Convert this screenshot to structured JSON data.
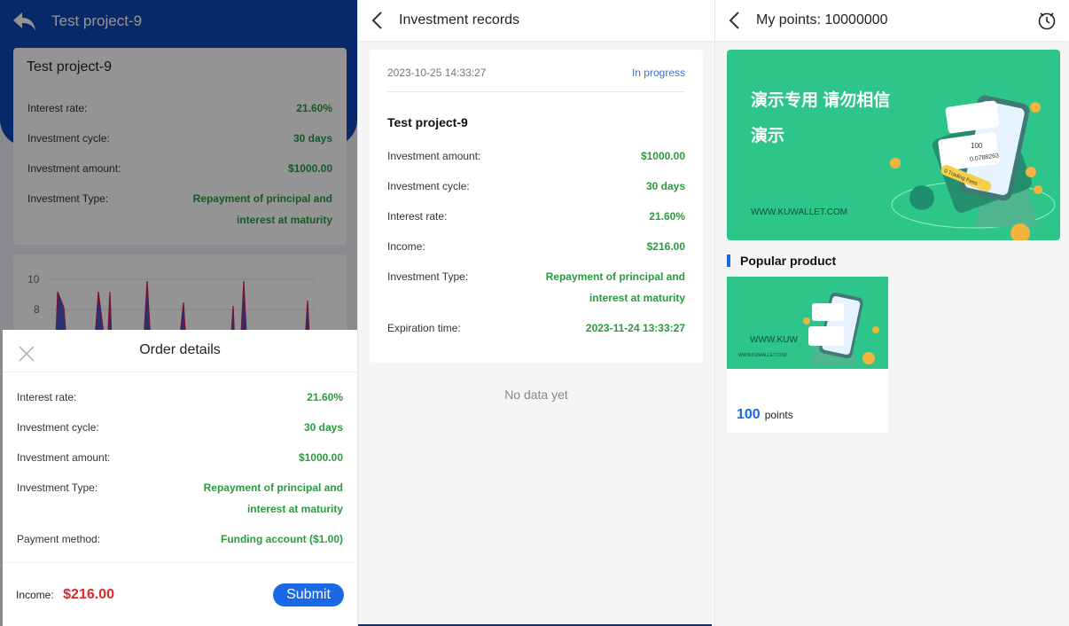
{
  "colors": {
    "brand_blue": "#0d47b5",
    "accent_blue": "#1968e6",
    "value_green": "#2a9a3f",
    "income_red": "#e0262b",
    "banner_green": "#2ec58a"
  },
  "project_page": {
    "title": "Test project-9",
    "card": {
      "title": "Test project-9",
      "rows": [
        {
          "label": "Interest rate:",
          "value": "21.60%"
        },
        {
          "label": "Investment cycle:",
          "value": "30 days"
        },
        {
          "label": "Investment amount:",
          "value": "$1000.00"
        },
        {
          "label": "Investment Type:",
          "value_line1": "Repayment of principal and",
          "value_line2": "interest at maturity"
        }
      ]
    },
    "chart_data": {
      "type": "area",
      "yticks": [
        "10",
        "8"
      ]
    }
  },
  "order_sheet": {
    "title": "Order details",
    "rows": [
      {
        "label": "Interest rate:",
        "value": "21.60%"
      },
      {
        "label": "Investment cycle:",
        "value": "30 days"
      },
      {
        "label": "Investment amount:",
        "value": "$1000.00"
      },
      {
        "label": "Investment Type:",
        "value_line1": "Repayment of principal and",
        "value_line2": "interest at maturity"
      },
      {
        "label": "Payment method:",
        "value": "Funding account ($1.00)"
      }
    ],
    "income_label": "Income:",
    "income_value": "$216.00",
    "submit_label": "Submit"
  },
  "records_page": {
    "title": "Investment records",
    "record": {
      "date": "2023-10-25 14:33:27",
      "status": "In progress",
      "name": "Test project-9",
      "rows": [
        {
          "label": "Investment amount:",
          "value": "$1000.00"
        },
        {
          "label": "Investment cycle:",
          "value": "30 days"
        },
        {
          "label": "Interest rate:",
          "value": "21.60%"
        },
        {
          "label": "Income:",
          "value": "$216.00"
        },
        {
          "label": "Investment Type:",
          "value_line1": "Repayment of principal and",
          "value_line2": "interest at maturity"
        },
        {
          "label": "Expiration time:",
          "value": "2023-11-24 13:33:27"
        }
      ]
    },
    "empty_text": "No data yet"
  },
  "points_page": {
    "title": "My points: 10000000",
    "banner": {
      "line1": "演示专用 请勿相信",
      "line2": "演示",
      "url": "WWW.KUWALLET.COM",
      "art_text": [
        "100",
        "0.0788263",
        "0 Trading Fees"
      ]
    },
    "section_title": "Popular product",
    "product": {
      "image_text_big": "WWW.KUW",
      "image_text_small": "WWW.KUWALLET.COM",
      "price": "100",
      "unit": "points"
    }
  }
}
